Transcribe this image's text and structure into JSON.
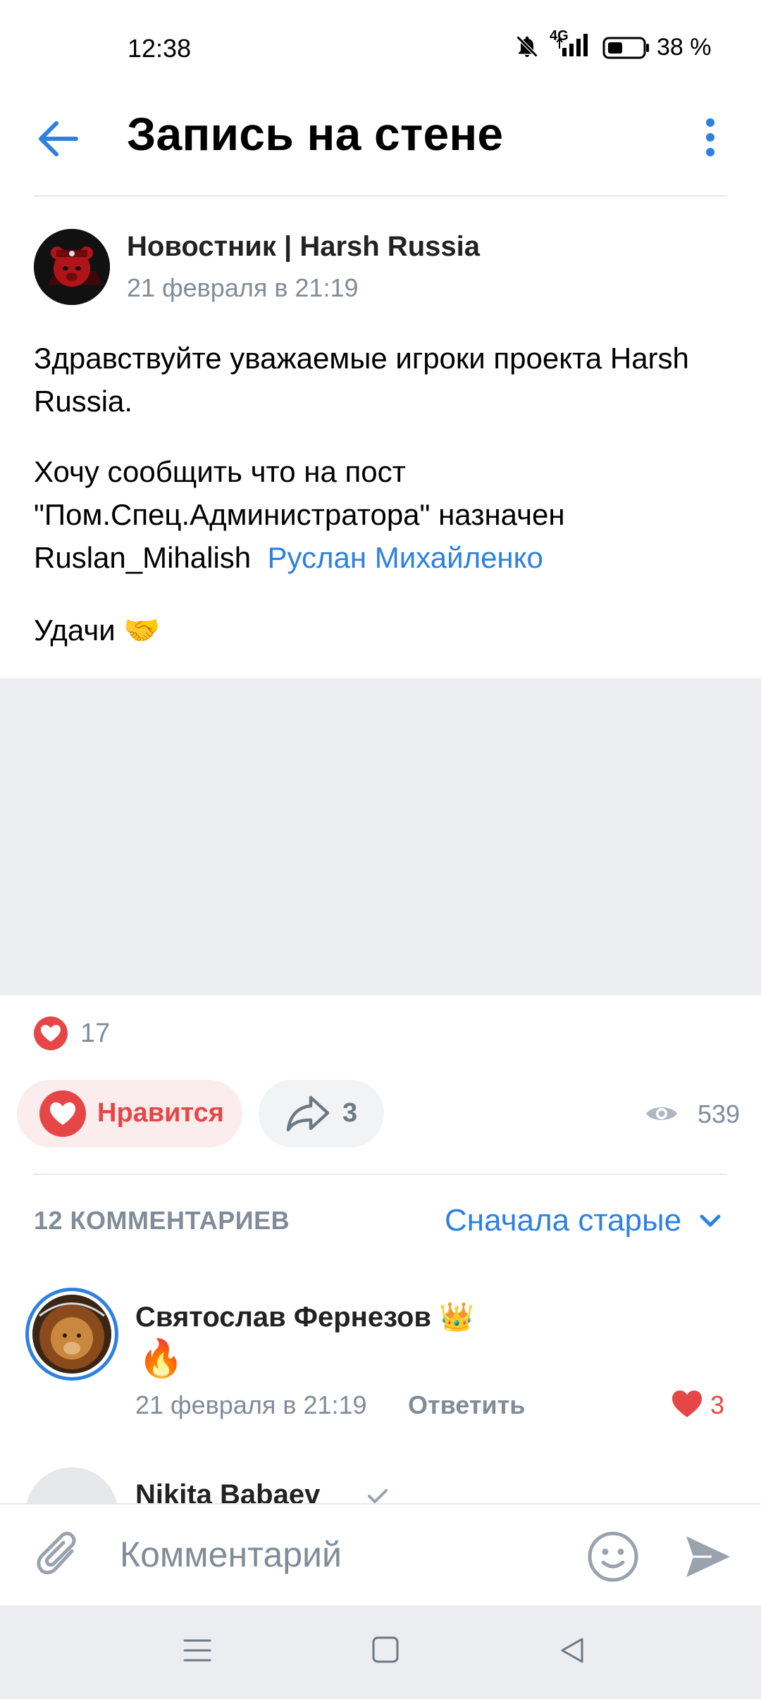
{
  "status_bar": {
    "time": "12:38",
    "network": "4G",
    "battery": "38 %",
    "icons": [
      "mute-bell-icon",
      "signal-icon",
      "battery-icon"
    ]
  },
  "header": {
    "title": "Запись на стене",
    "back_icon": "arrow-left-icon",
    "menu_icon": "more-vertical-icon"
  },
  "post": {
    "author": "Новостник | Harsh Russia",
    "date": "21 февраля в 21:19",
    "paragraph1": "Здравствуйте уважаемые игроки проекта Harsh Russia.",
    "paragraph2": "Хочу сообщить что на пост \"Пом.Спец.Администратора\" назначен Ruslan_Mihalish",
    "mention": "Руслан Михайленко",
    "paragraph3": "Удачи 🤝",
    "likes_count": "17",
    "like_button_label": "Нравится",
    "share_count": "3",
    "views_count": "539"
  },
  "comments": {
    "header": "12 КОММЕНТАРИЕВ",
    "sort_label": "Сначала старые",
    "items": [
      {
        "author": "Святослав Фернезов 👑",
        "text": "🔥",
        "date": "21 февраля в 21:19",
        "reply_label": "Ответить",
        "likes": "3"
      },
      {
        "author": "Nikita Babaev"
      }
    ]
  },
  "comment_input": {
    "placeholder": "Комментарий"
  },
  "colors": {
    "accent": "#2d81e0",
    "like_red": "#e64646",
    "secondary_text": "#818c99",
    "media_placeholder": "#ebedf0"
  }
}
